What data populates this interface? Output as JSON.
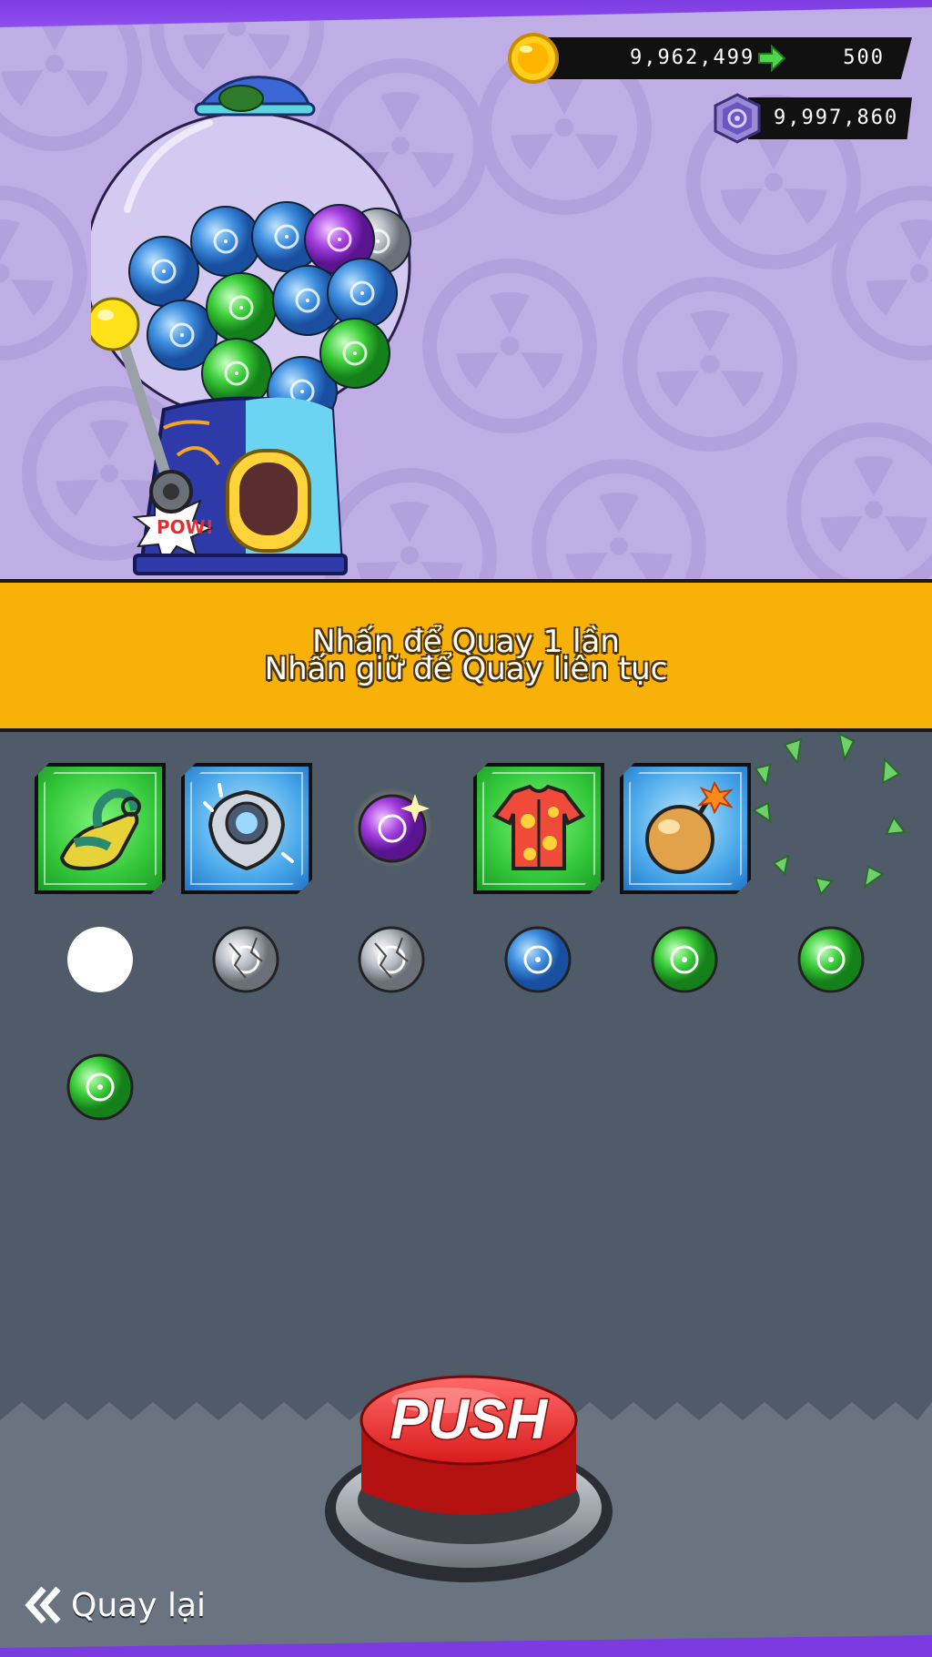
{
  "currency": {
    "coins": "9,962,499",
    "coin_cost": "500",
    "gems": "9,997,860",
    "coin_icon": "gold-coin-icon",
    "gem_icon": "purple-gem-icon",
    "arrow_icon": "green-arrow-icon"
  },
  "banner": {
    "line1": "Nhấn để Quay 1 lần",
    "line2": "Nhấn giữ để Quay liên tục",
    "color": "#f8b108"
  },
  "rewards": {
    "row1": [
      {
        "type": "card",
        "frame": "green",
        "icon": "sandal-icon"
      },
      {
        "type": "card",
        "frame": "blue",
        "icon": "silver-shield-icon"
      },
      {
        "type": "ball",
        "color": "purple",
        "icon": "purple-sparkle-ball-icon"
      },
      {
        "type": "card",
        "frame": "green",
        "icon": "hawaiian-shirt-icon"
      },
      {
        "type": "card",
        "frame": "blue",
        "icon": "bomb-icon"
      },
      {
        "type": "burst",
        "icon": "green-shell-burst-icon"
      }
    ],
    "row2": [
      {
        "color": "white",
        "icon": "white-ball-icon"
      },
      {
        "color": "silver",
        "icon": "silver-cracked-ball-icon"
      },
      {
        "color": "silver",
        "icon": "silver-cracked-ball-icon"
      },
      {
        "color": "blue",
        "icon": "blue-ball-icon"
      },
      {
        "color": "green",
        "icon": "green-ball-icon"
      },
      {
        "color": "green",
        "icon": "green-ball-icon"
      }
    ],
    "row3": [
      {
        "color": "green",
        "icon": "green-ball-icon"
      }
    ]
  },
  "machine": {
    "icon": "gumball-machine-icon",
    "sticker_text": "POW!"
  },
  "push_button": {
    "label": "PUSH"
  },
  "back": {
    "label": "Quay lại",
    "icon": "double-chevron-left-icon"
  },
  "colors": {
    "background": "#bfaee6",
    "floor": "#4f5b68",
    "accent": "#7c3be0"
  }
}
